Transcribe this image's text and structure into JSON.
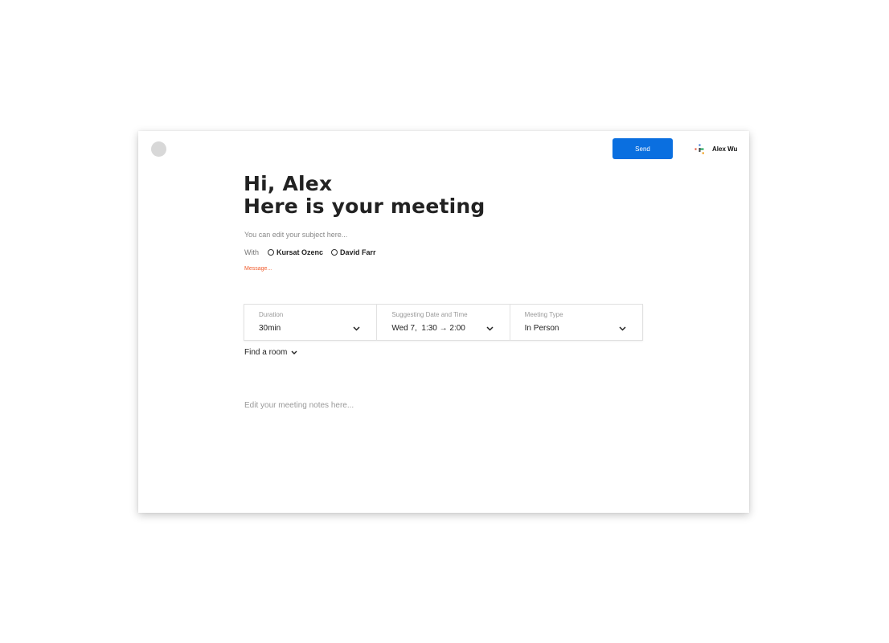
{
  "header": {
    "send_label": "Send",
    "user_name": "Alex Wu"
  },
  "greeting": {
    "line1": "Hi, Alex",
    "line2": "Here is your meeting"
  },
  "subject_placeholder": "You can edit your subject here...",
  "attendees": {
    "label": "With",
    "people": [
      "Kursat Ozenc",
      "David Farr"
    ]
  },
  "message_placeholder": "Message...",
  "fields": {
    "duration": {
      "label": "Duration",
      "value": "30min"
    },
    "datetime": {
      "label": "Suggesting Date and Time",
      "value": "Wed 7,  1:30 → 2:00"
    },
    "meeting_type": {
      "label": "Meeting Type",
      "value": "In Person"
    }
  },
  "find_room_label": "Find a room",
  "notes_placeholder": "Edit your meeting notes here...",
  "colors": {
    "accent": "#0a6fe0",
    "message": "#f05a2a"
  }
}
